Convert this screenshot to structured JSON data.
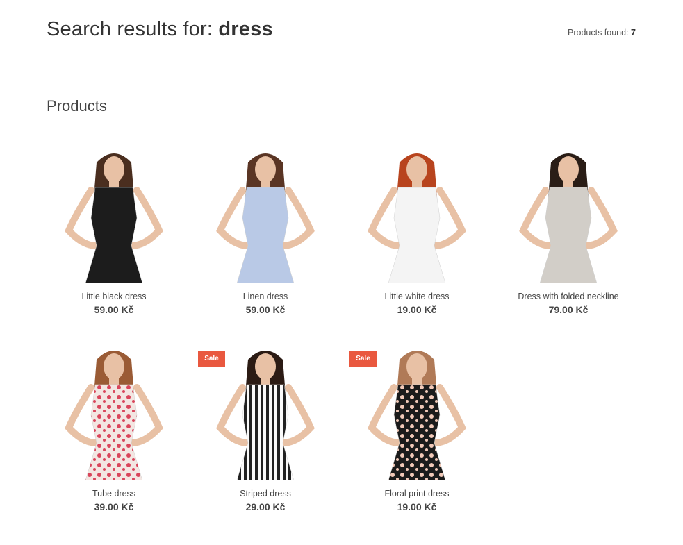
{
  "header": {
    "title_prefix": "Search results for:",
    "query": "dress",
    "found_label": "Products found:",
    "found_count": "7"
  },
  "section": {
    "title": "Products"
  },
  "products": [
    {
      "name": "Little black dress",
      "price": "59.00 Kč",
      "sale": false,
      "dress_color": "#1c1c1c",
      "hair_color": "#4a2e1f"
    },
    {
      "name": "Linen dress",
      "price": "59.00 Kč",
      "sale": false,
      "dress_color": "#b9c9e6",
      "hair_color": "#5a3524"
    },
    {
      "name": "Little white dress",
      "price": "19.00 Kč",
      "sale": false,
      "dress_color": "#f4f4f4",
      "hair_color": "#b8441e"
    },
    {
      "name": "Dress with folded neckline",
      "price": "79.00 Kč",
      "sale": false,
      "dress_color": "#d2cec8",
      "hair_color": "#2a1d16"
    },
    {
      "name": "Tube dress",
      "price": "39.00 Kč",
      "sale": false,
      "dress_color": "#f3e6e2",
      "hair_color": "#9a5b35"
    },
    {
      "name": "Striped dress",
      "price": "29.00 Kč",
      "sale": true,
      "dress_color": "#222222",
      "hair_color": "#2b1b14"
    },
    {
      "name": "Floral print dress",
      "price": "19.00 Kč",
      "sale": true,
      "dress_color": "#1b1b1b",
      "hair_color": "#b07a57"
    }
  ],
  "badge": {
    "sale_label": "Sale"
  }
}
